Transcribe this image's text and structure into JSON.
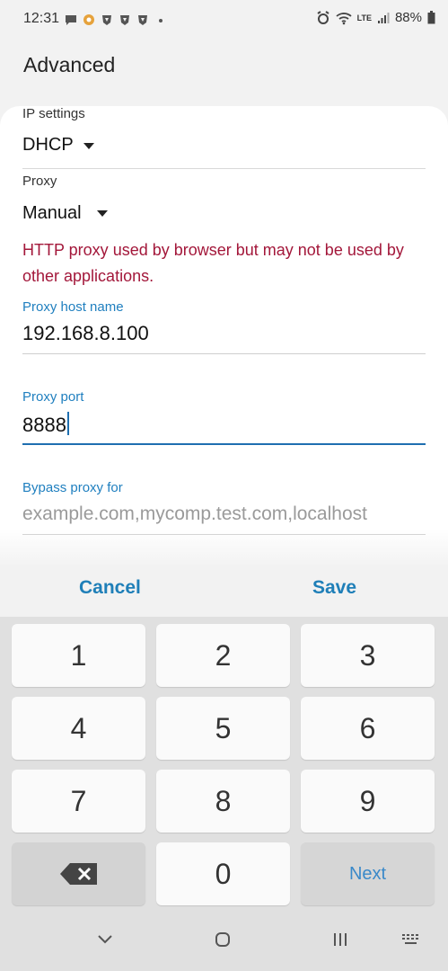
{
  "status_bar": {
    "time": "12:31",
    "battery": "88%",
    "network": "LTE"
  },
  "header": {
    "title": "Advanced"
  },
  "settings": {
    "ip_settings": {
      "label": "IP settings",
      "value": "DHCP"
    },
    "proxy": {
      "label": "Proxy",
      "value": "Manual"
    },
    "warning": "HTTP proxy used by browser but may not be used by other applications.",
    "proxy_host": {
      "label": "Proxy host name",
      "value": "192.168.8.100"
    },
    "proxy_port": {
      "label": "Proxy port",
      "value": "8888"
    },
    "bypass": {
      "label": "Bypass proxy for",
      "placeholder": "example.com,mycomp.test.com,localhost"
    }
  },
  "actions": {
    "cancel": "Cancel",
    "save": "Save"
  },
  "keyboard": {
    "keys": [
      "1",
      "2",
      "3",
      "4",
      "5",
      "6",
      "7",
      "8",
      "9",
      "0"
    ],
    "next": "Next"
  },
  "colors": {
    "accent": "#1f7fbf",
    "warning": "#a3173a",
    "keyboard_bg": "#e0e0e0"
  }
}
